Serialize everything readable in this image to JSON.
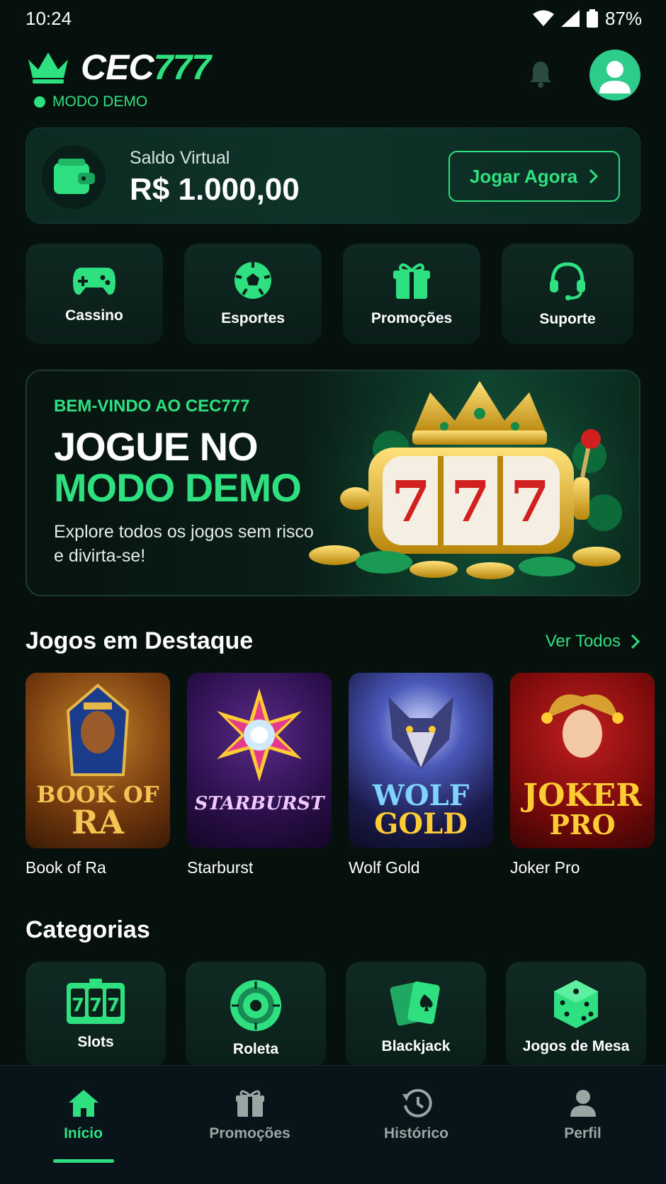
{
  "status_bar": {
    "time": "10:24",
    "battery": "87%"
  },
  "header": {
    "logo_white": "CEC",
    "logo_green": "777",
    "mode_label": "MODO DEMO"
  },
  "balance": {
    "label": "Saldo Virtual",
    "value": "R$ 1.000,00",
    "button_label": "Jogar Agora"
  },
  "quick_links": [
    {
      "label": "Cassino",
      "icon": "gamepad-icon"
    },
    {
      "label": "Esportes",
      "icon": "soccer-ball-icon"
    },
    {
      "label": "Promoções",
      "icon": "gift-icon"
    },
    {
      "label": "Suporte",
      "icon": "headset-icon"
    }
  ],
  "banner": {
    "kicker": "BEM-VINDO AO CEC777",
    "title_line1": "JOGUE NO",
    "title_line2": "MODO DEMO",
    "description": "Explore todos os jogos sem risco e divirta-se!"
  },
  "featured": {
    "title": "Jogos em Destaque",
    "see_all": "Ver Todos",
    "games": [
      {
        "name": "Book of Ra",
        "art_title_1": "BOOK OF",
        "art_title_2": "RA"
      },
      {
        "name": "Starburst",
        "art_title_1": "STARBURST",
        "art_title_2": ""
      },
      {
        "name": "Wolf Gold",
        "art_title_1": "WOLF",
        "art_title_2": "GOLD"
      },
      {
        "name": "Joker Pro",
        "art_title_1": "JOKER",
        "art_title_2": "PRO"
      }
    ]
  },
  "categories": {
    "title": "Categorias",
    "items": [
      {
        "label": "Slots",
        "icon": "slot-machine-icon"
      },
      {
        "label": "Roleta",
        "icon": "roulette-icon"
      },
      {
        "label": "Blackjack",
        "icon": "cards-icon"
      },
      {
        "label": "Jogos de Mesa",
        "icon": "dice-icon"
      }
    ]
  },
  "bottom_nav": [
    {
      "label": "Início",
      "icon": "home-icon",
      "active": true
    },
    {
      "label": "Promoções",
      "icon": "gift-icon",
      "active": false
    },
    {
      "label": "Histórico",
      "icon": "history-icon",
      "active": false
    },
    {
      "label": "Perfil",
      "icon": "user-icon",
      "active": false
    }
  ],
  "colors": {
    "accent": "#2ee07f",
    "background": "#06110e"
  }
}
